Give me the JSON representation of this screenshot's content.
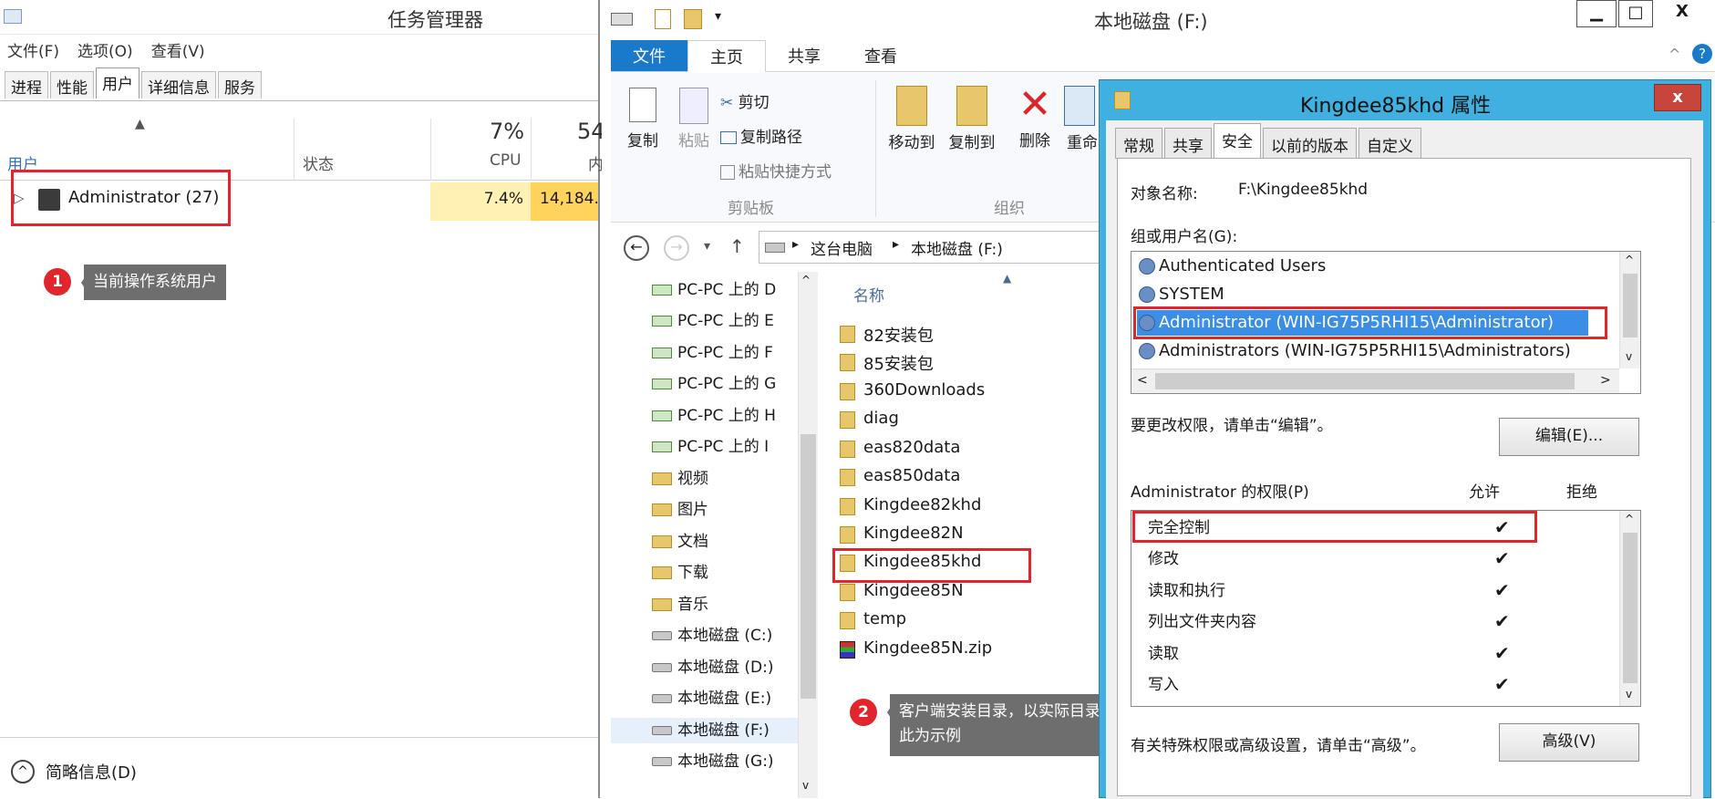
{
  "task_manager": {
    "title": "任务管理器",
    "menu": [
      "文件(F)",
      "选项(O)",
      "查看(V)"
    ],
    "tabs": [
      "进程",
      "性能",
      "用户",
      "详细信息",
      "服务"
    ],
    "active_tab": "用户",
    "columns": {
      "user": "用户",
      "status": "状态",
      "cpu_pct": "7%",
      "cpu_label": "CPU",
      "mem_pct": "54",
      "mem_label": "内"
    },
    "row": {
      "expander": "▷",
      "name": "Administrator (27)",
      "cpu": "7.4%",
      "mem": "14,184."
    },
    "callout_1": {
      "num": "1",
      "text": "当前操作系统用户"
    },
    "footer": "简略信息(D)"
  },
  "explorer": {
    "title": "本地磁盘 (F:)",
    "window_buttons": [
      "▁",
      "□",
      "X"
    ],
    "ribbon_tabs": [
      "文件",
      "主页",
      "共享",
      "查看"
    ],
    "ribbon": {
      "copy": "复制",
      "paste": "粘贴",
      "cut": "剪切",
      "copy_path": "复制路径",
      "paste_shortcut": "粘贴快捷方式",
      "move_to": "移动到",
      "copy_to": "复制到",
      "delete": "删除",
      "rename": "重命",
      "group_clipboard": "剪贴板",
      "group_organize": "组织"
    },
    "address": [
      "这台电脑",
      "本地磁盘 (F:)"
    ],
    "nav_items": [
      "PC-PC 上的 D",
      "PC-PC 上的 E",
      "PC-PC 上的 F",
      "PC-PC 上的 G",
      "PC-PC 上的 H",
      "PC-PC 上的 I",
      "视频",
      "图片",
      "文档",
      "下载",
      "音乐",
      "本地磁盘 (C:)",
      "本地磁盘 (D:)",
      "本地磁盘 (E:)",
      "本地磁盘 (F:)",
      "本地磁盘 (G:)"
    ],
    "column_name": "名称",
    "files": [
      "82安装包",
      "85安装包",
      "360Downloads",
      "diag",
      "eas820data",
      "eas850data",
      "Kingdee82khd",
      "Kingdee82N",
      "Kingdee85khd",
      "Kingdee85N",
      "temp",
      "Kingdee85N.zip"
    ],
    "callout_2": {
      "num": "2",
      "text": "客户端安装目录，以实际目录为准此为示例"
    }
  },
  "dialog": {
    "title": "Kingdee85khd 属性",
    "close": "x",
    "tabs": [
      "常规",
      "共享",
      "安全",
      "以前的版本",
      "自定义"
    ],
    "active_tab": "安全",
    "object_label": "对象名称:",
    "object_value": "F:\\Kingdee85khd",
    "group_label": "组或用户名(G):",
    "users": [
      "Authenticated Users",
      "SYSTEM",
      "Administrator (WIN-IG75P5RHI15\\Administrator)",
      "Administrators (WIN-IG75P5RHI15\\Administrators)"
    ],
    "selected_user": "Administrator (WIN-IG75P5RHI15\\Administrator)",
    "change_hint": "要更改权限，请单击“编辑”。",
    "edit_button": "编辑(E)...",
    "perm_header": "Administrator 的权限(P)",
    "allow": "允许",
    "deny": "拒绝",
    "permissions": [
      "完全控制",
      "修改",
      "读取和执行",
      "列出文件夹内容",
      "读取",
      "写入"
    ],
    "check": "✔",
    "advanced_hint": "有关特殊权限或高级设置，请单击“高级”。",
    "advanced_button": "高级(V)"
  }
}
